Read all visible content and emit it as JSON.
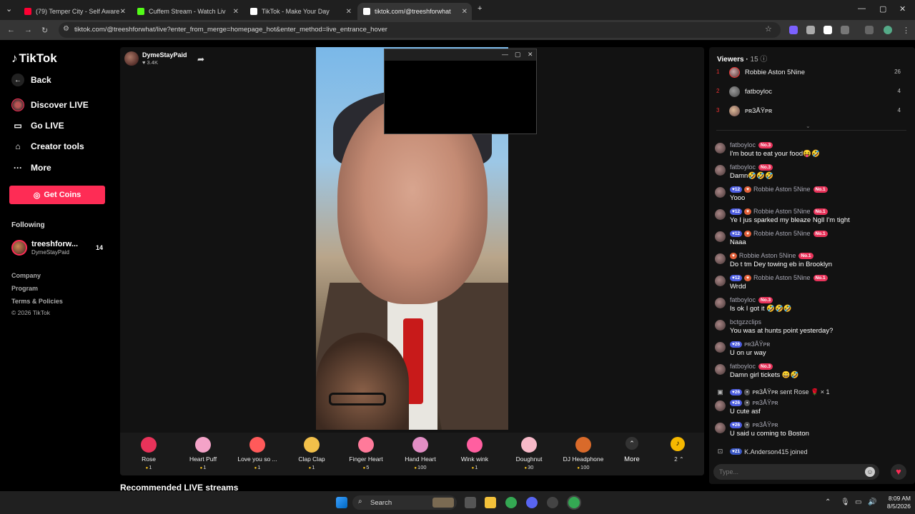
{
  "browser": {
    "tabs": [
      {
        "title": "(79) Temper City - Self Aware -",
        "color": "#ff0033"
      },
      {
        "title": "Cuffem Stream - Watch Liv",
        "color": "#53fc18"
      },
      {
        "title": "TikTok - Make Your Day",
        "color": "#ffffff"
      },
      {
        "title": "tiktok.com/@treeshforwhat",
        "color": "#ffffff"
      }
    ],
    "url": "tiktok.com/@treeshforwhat/live?enter_from_merge=homepage_hot&enter_method=live_entrance_hover"
  },
  "sidebar": {
    "logo": "TikTok",
    "back": "Back",
    "nav": [
      {
        "label": "Discover LIVE",
        "icon": "live-icon"
      },
      {
        "label": "Go LIVE",
        "icon": "camera-icon"
      },
      {
        "label": "Creator tools",
        "icon": "home-icon"
      },
      {
        "label": "More",
        "icon": "more-icon"
      }
    ],
    "get_coins": "Get Coins",
    "following_title": "Following",
    "following": {
      "name": "treeshforw...",
      "sub": "DymeStayPaid",
      "count": "14"
    },
    "footer": [
      "Company",
      "Program",
      "Terms & Policies",
      "© 2026 TikTok"
    ]
  },
  "stream": {
    "host_name": "DymeStayPaid",
    "host_likes": "3.4K",
    "recommended": "Recommended LIVE streams"
  },
  "gifts": [
    {
      "name": "Rose",
      "price": "1",
      "color": "#e8335a"
    },
    {
      "name": "Heart Puff",
      "price": "1",
      "color": "#f4a3c8"
    },
    {
      "name": "Love you so ...",
      "price": "1",
      "color": "#ff5a5a"
    },
    {
      "name": "Clap Clap",
      "price": "1",
      "color": "#f2c04a"
    },
    {
      "name": "Finger Heart",
      "price": "5",
      "color": "#ff7a9a"
    },
    {
      "name": "Hand Heart",
      "price": "100",
      "color": "#e28ec4"
    },
    {
      "name": "Wink wink",
      "price": "1",
      "color": "#ff5fa0"
    },
    {
      "name": "Doughnut",
      "price": "30",
      "color": "#f7b9c8"
    },
    {
      "name": "DJ Headphone",
      "price": "100",
      "color": "#d96a2a"
    }
  ],
  "gift_more": "More",
  "wallet_count": "2",
  "viewers": {
    "title": "Viewers",
    "count": "15",
    "list": [
      {
        "rank": "1",
        "name": "Robbie Aston 5Nine",
        "score": "26"
      },
      {
        "rank": "2",
        "name": "fatboyloc",
        "score": "4"
      },
      {
        "rank": "3",
        "name": "ᴘʀ3ÅŸᴘʀ",
        "score": "4"
      }
    ]
  },
  "chat": [
    {
      "user": "fatboyloc",
      "lvl": "",
      "fan": false,
      "rank": "No.3",
      "text": "I'm bout to eat your food😝🤣"
    },
    {
      "user": "fatboyloc",
      "lvl": "",
      "fan": false,
      "rank": "No.3",
      "text": "Damn🤣🤣🤣"
    },
    {
      "user": "Robbie Aston 5Nine",
      "lvl": "12",
      "fan": true,
      "rank": "No.1",
      "text": "Yooo"
    },
    {
      "user": "Robbie Aston 5Nine",
      "lvl": "12",
      "fan": true,
      "rank": "No.1",
      "text": "Ye I jus sparked my bleaze Ngll I'm tight"
    },
    {
      "user": "Robbie Aston 5Nine",
      "lvl": "12",
      "fan": true,
      "rank": "No.1",
      "text": "Naaa"
    },
    {
      "user": "Robbie Aston 5Nine",
      "lvl": "",
      "fan": true,
      "rank": "No.1",
      "text": "Do t tm Dey towing eb in Brooklyn"
    },
    {
      "user": "Robbie Aston 5Nine",
      "lvl": "12",
      "fan": true,
      "rank": "No.1",
      "text": "Wrdd"
    },
    {
      "user": "fatboyloc",
      "lvl": "",
      "fan": false,
      "rank": "No.3",
      "text": "Is ok I got it 🤣🤣🤣"
    },
    {
      "user": "bctgzzclips",
      "lvl": "",
      "fan": false,
      "rank": "",
      "text": "You was at hunts point yesterday?"
    },
    {
      "user": "ᴘʀ3ÅŸᴘʀ",
      "lvl": "26",
      "fan": false,
      "rank": "",
      "text": "U on ur way"
    },
    {
      "user": "fatboyloc",
      "lvl": "",
      "fan": false,
      "rank": "No.3",
      "text": "Damn girl tickets 😄🤣"
    }
  ],
  "gift_line": {
    "lvl": "26",
    "text": "ᴘʀ3ÅŸᴘʀ sent Rose 🌹 × 1"
  },
  "chat_after": [
    {
      "user": "ᴘʀ3ÅŸᴘʀ",
      "lvl": "26",
      "text": "U cute asf"
    },
    {
      "user": "ᴘʀ3ÅŸᴘʀ",
      "lvl": "26",
      "text": "U said u coming to Boston"
    }
  ],
  "join_line": {
    "lvl": "21",
    "text": "K.Anderson415 joined"
  },
  "input_placeholder": "Type...",
  "taskbar": {
    "search": "Search",
    "time": "8:09 AM",
    "date": "8/5/2026"
  }
}
